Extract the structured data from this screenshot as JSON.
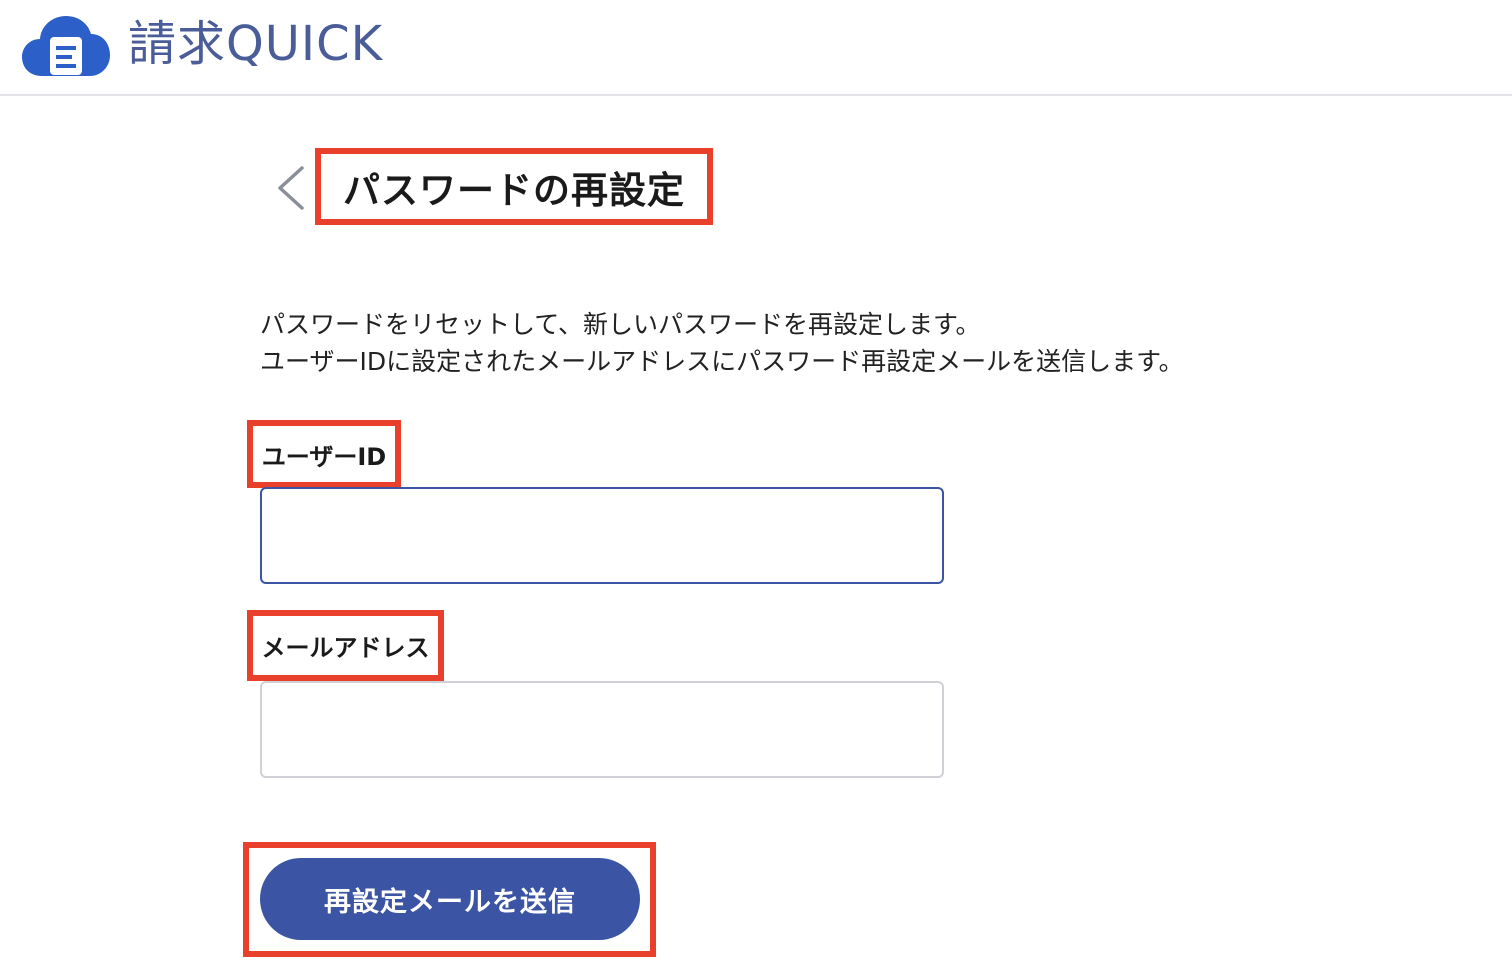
{
  "header": {
    "logo_icon": "cloud-document-icon",
    "logo_text": "請求QUICK",
    "brand_color": "#2c5fc8"
  },
  "page": {
    "back_icon": "chevron-left-icon",
    "title": "パスワードの再設定",
    "description_line1": "パスワードをリセットして、新しいパスワードを再設定します。",
    "description_line2": "ユーザーIDに設定されたメールアドレスにパスワード再設定メールを送信します。"
  },
  "form": {
    "userid_label": "ユーザーID",
    "userid_value": "",
    "email_label": "メールアドレス",
    "email_value": "",
    "submit_label": "再設定メールを送信"
  },
  "colors": {
    "highlight": "#e8402a",
    "button": "#3b54a3",
    "input_focus_border": "#3b54a3"
  }
}
